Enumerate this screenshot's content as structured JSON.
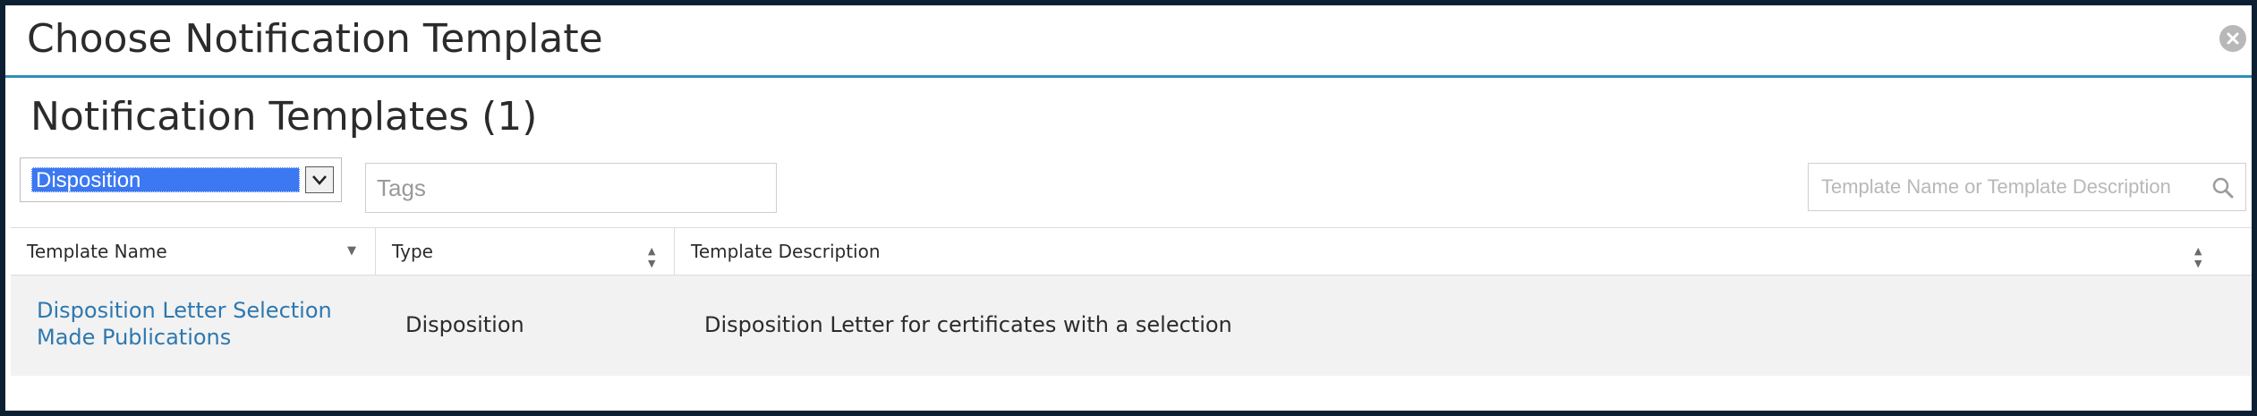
{
  "dialog": {
    "title": "Choose Notification Template",
    "close_icon": "close-circle-icon"
  },
  "section": {
    "title": "Notification Templates (1)"
  },
  "filters": {
    "type_select": {
      "selected": "Disposition",
      "icon": "chevron-down-icon"
    },
    "tags": {
      "placeholder": "Tags",
      "value": ""
    },
    "search": {
      "placeholder": "Template Name or Template Description",
      "value": "",
      "icon": "search-icon"
    }
  },
  "grid": {
    "columns": [
      {
        "label": "Template Name",
        "sort_icon": "sort-desc-icon"
      },
      {
        "label": "Type",
        "sort_icon": "sort-both-icon"
      },
      {
        "label": "Template Description",
        "sort_icon": "sort-both-icon"
      }
    ],
    "rows": [
      {
        "name_line1": "Disposition Letter Selection",
        "name_line2": "Made Publications",
        "type": "Disposition",
        "description": "Disposition Letter for certificates with a selection"
      }
    ]
  },
  "colors": {
    "frame": "#0d1f33",
    "header_rule": "#2e8fb8",
    "link": "#2d78b0",
    "select_highlight": "#3b78f2",
    "row_bg": "#f2f2f2"
  }
}
